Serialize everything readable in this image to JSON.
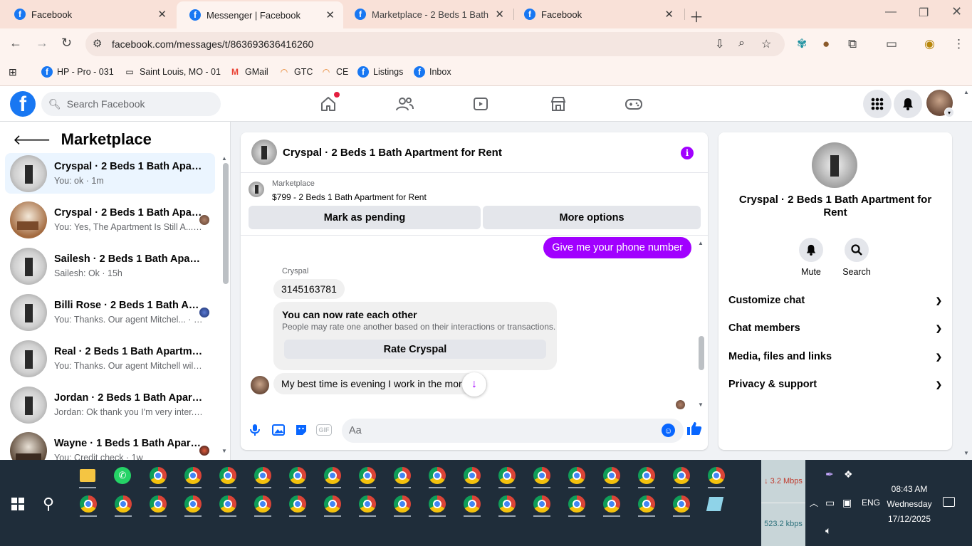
{
  "browser": {
    "tabs": [
      {
        "title": "Facebook"
      },
      {
        "title": "Messenger | Facebook"
      },
      {
        "title": "Marketplace - 2 Beds 1 Bath Ap"
      },
      {
        "title": "Facebook"
      }
    ],
    "url": "facebook.com/messages/t/863693636416260",
    "bookmarks": [
      {
        "label": "HP - Pro - 031"
      },
      {
        "label": "Saint Louis, MO - 01"
      },
      {
        "label": "GMail"
      },
      {
        "label": "GTC"
      },
      {
        "label": "CE"
      },
      {
        "label": "Listings"
      },
      {
        "label": "Inbox"
      }
    ]
  },
  "fb": {
    "search_placeholder": "Search Facebook"
  },
  "left": {
    "title": "Marketplace",
    "conversations": [
      {
        "name": "Cryspal · 2 Beds 1 Bath Apartme...",
        "snippet": "You: ok · 1m"
      },
      {
        "name": "Cryspal · 2 Beds 1 Bath Apart...",
        "snippet": "You: Yes, The Apartment Is Still A... · 2h"
      },
      {
        "name": "Sailesh · 2 Beds 1 Bath Apartme...",
        "snippet": "Sailesh: Ok · 15h"
      },
      {
        "name": "Billi Rose · 2 Beds 1 Bath Apar...",
        "snippet": "You: Thanks. Our agent Mitchel... · 19h"
      },
      {
        "name": "Real · 2 Beds 1 Bath Apartment f...",
        "snippet": "You: Thanks. Our agent Mitchell wil... · 1d"
      },
      {
        "name": "Jordan · 2 Beds 1 Bath Apartme...",
        "snippet": "Jordan: Ok thank you I'm very inter... · 2d"
      },
      {
        "name": "Wayne · 1 Beds 1 Bath Apartm...",
        "snippet": "You: Credit check · 1w"
      }
    ]
  },
  "chat": {
    "title": "Cryspal · 2 Beds 1 Bath Apartment for Rent",
    "listing_source": "Marketplace",
    "listing_price_title": "$799 - 2 Beds 1 Bath Apartment for Rent",
    "mark_pending": "Mark as pending",
    "more_options": "More options",
    "outgoing_msg": "Give me your phone number",
    "sender_name": "Cryspal",
    "incoming_phone": "3145163781",
    "rate_title": "You can now rate each other",
    "rate_sub": "People may rate one another based on their interactions or transactions.",
    "rate_button": "Rate Cryspal",
    "incoming_last": "My best time is evening I work in the morn",
    "composer_placeholder": "Aa",
    "gif_label": "GIF"
  },
  "info": {
    "name": "Cryspal · 2 Beds 1 Bath Apartment for Rent",
    "mute_label": "Mute",
    "search_label": "Search",
    "sections": [
      {
        "label": "Customize chat"
      },
      {
        "label": "Chat members"
      },
      {
        "label": "Media, files and links"
      },
      {
        "label": "Privacy & support"
      }
    ]
  },
  "taskbar": {
    "net_down": "3.2 Mbps",
    "net_up": "523.2 kbps",
    "lang": "ENG",
    "time": "08:43 AM",
    "day": "Wednesday",
    "date": "17/12/2025"
  },
  "colors": {
    "fb_blue": "#1877f2",
    "messenger_purple": "#a100ff",
    "active_conv_bg": "#ebf5ff"
  }
}
